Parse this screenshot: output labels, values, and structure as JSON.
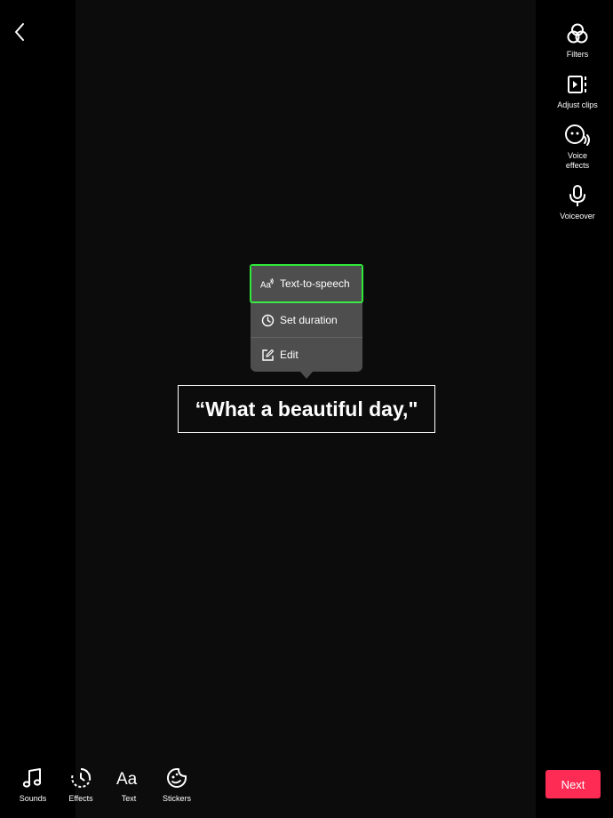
{
  "right_toolbar": {
    "filters": {
      "label": "Filters",
      "icon": "filters-icon"
    },
    "adjust_clips": {
      "label": "Adjust clips",
      "icon": "adjust-clips-icon"
    },
    "voice_effects": {
      "label": "Voice\neffects",
      "icon": "voice-effects-icon"
    },
    "voiceover": {
      "label": "Voiceover",
      "icon": "microphone-icon"
    }
  },
  "popup_menu": {
    "text_to_speech": {
      "label": "Text-to-speech",
      "icon": "text-to-speech-icon"
    },
    "set_duration": {
      "label": "Set duration",
      "icon": "clock-icon"
    },
    "edit": {
      "label": "Edit",
      "icon": "edit-icon"
    }
  },
  "caption": {
    "text": "“What a beautiful day,\""
  },
  "bottom_toolbar": {
    "sounds": {
      "label": "Sounds",
      "icon": "music-note-icon"
    },
    "effects": {
      "label": "Effects",
      "icon": "effects-timer-icon"
    },
    "text": {
      "label": "Text",
      "icon": "text-aa-icon"
    },
    "stickers": {
      "label": "Stickers",
      "icon": "sticker-icon"
    }
  },
  "next_button": {
    "label": "Next"
  },
  "colors": {
    "accent": "#fe2c55",
    "highlight": "#2ee83a",
    "popup_bg": "#555555"
  }
}
